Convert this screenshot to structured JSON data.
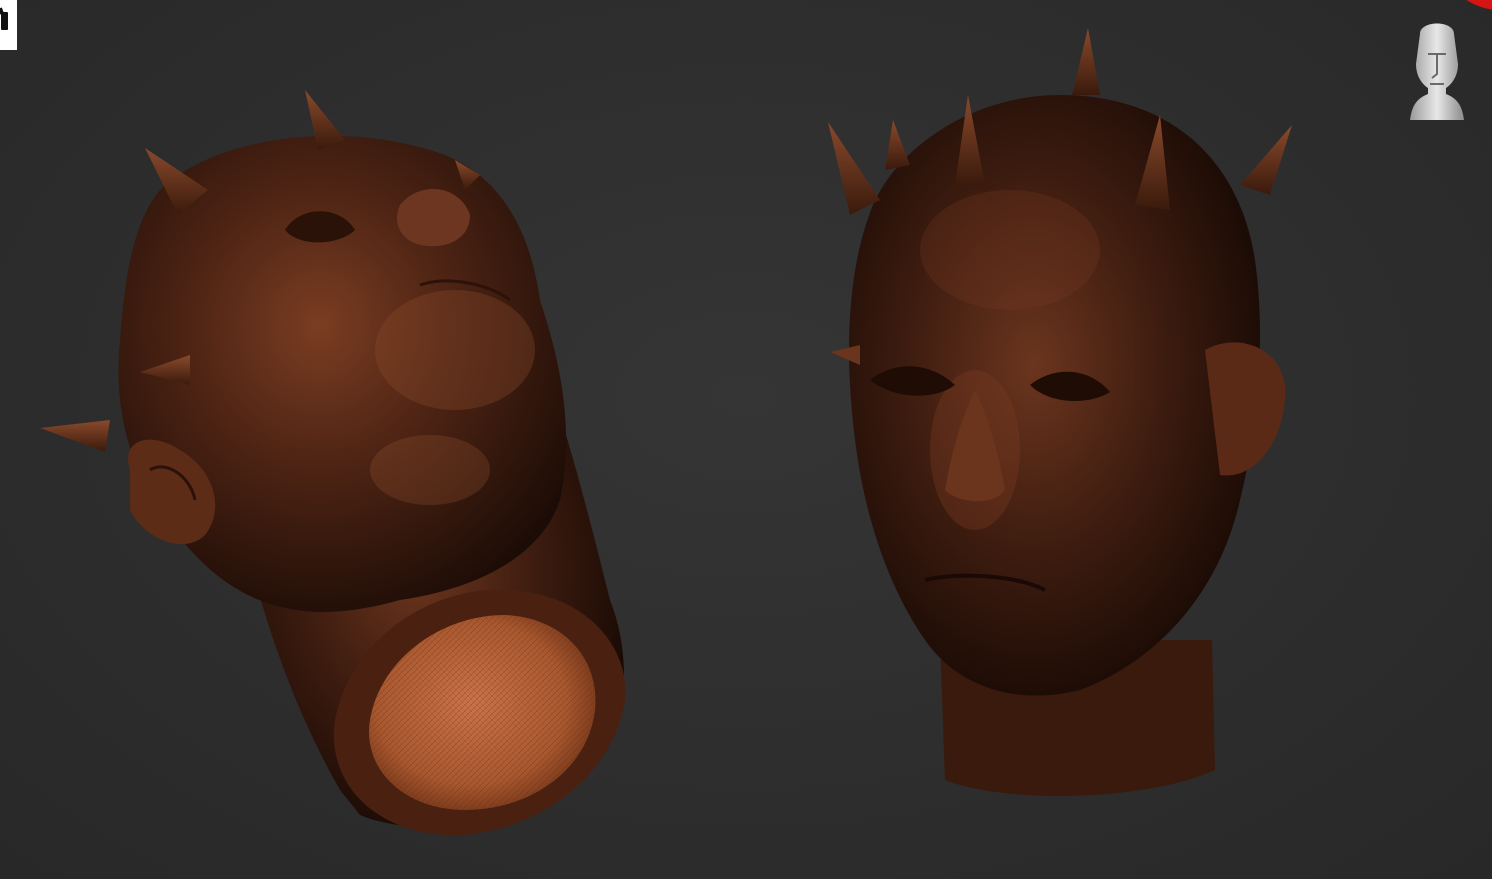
{
  "viewport": {
    "background": "#2f2f2f",
    "accent": "#d61414"
  },
  "icons": {
    "corner_marker": "tool-marker-icon",
    "navigation": "head-navigation-gizmo-icon"
  },
  "models": [
    {
      "name": "head-tilted-back",
      "surface_color": "#5a2a17",
      "cap_color": "#b5633a"
    },
    {
      "name": "head-front-view",
      "surface_color": "#4e2716"
    }
  ]
}
